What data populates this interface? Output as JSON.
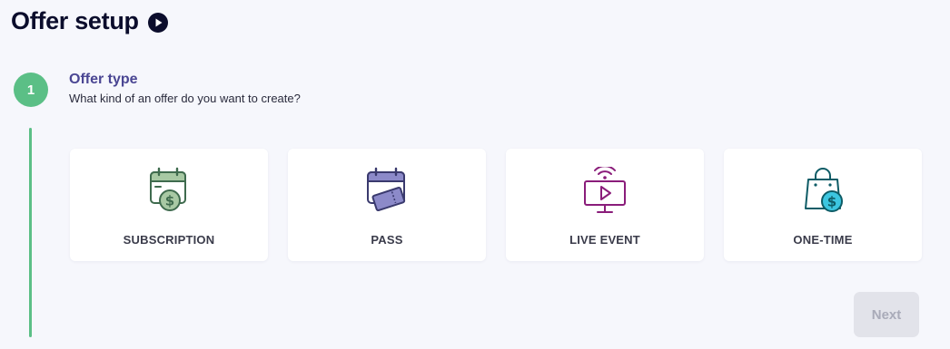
{
  "header": {
    "title": "Offer setup",
    "play_icon": "play-circle-icon"
  },
  "step": {
    "number": "1",
    "title": "Offer type",
    "subtitle": "What kind of an offer do you want to create?",
    "accent_color": "#5bbf86"
  },
  "offer_types": [
    {
      "label": "SUBSCRIPTION",
      "icon": "calendar-dollar-icon",
      "color": "#3f6b4e"
    },
    {
      "label": "PASS",
      "icon": "calendar-ticket-icon",
      "color": "#3a3a6e"
    },
    {
      "label": "LIVE EVENT",
      "icon": "broadcast-screen-icon",
      "color": "#8a1d7a"
    },
    {
      "label": "ONE-TIME",
      "icon": "shopping-bag-dollar-icon",
      "color": "#0e5c66"
    }
  ],
  "footer": {
    "next_label": "Next",
    "next_enabled": false
  }
}
